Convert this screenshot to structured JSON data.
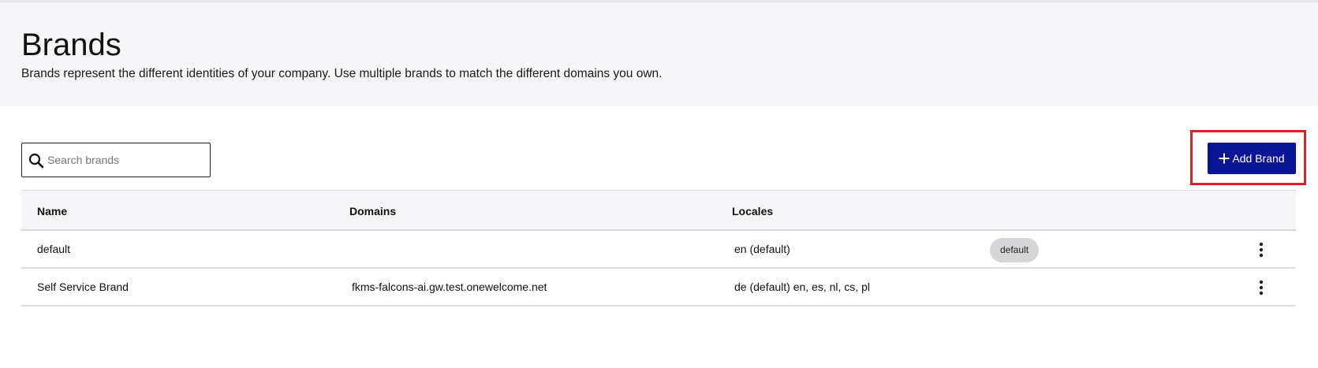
{
  "header": {
    "title": "Brands",
    "description": "Brands represent the different identities of your company. Use multiple brands to match the different domains you own."
  },
  "toolbar": {
    "search_placeholder": "Search brands",
    "search_value": "",
    "add_label": "Add Brand"
  },
  "table": {
    "columns": [
      "Name",
      "Domains",
      "Locales"
    ],
    "rows": [
      {
        "name": "default",
        "domains": "",
        "locales": "en (default)",
        "badge": "default"
      },
      {
        "name": "Self Service Brand",
        "domains": "fkms-falcons-ai.gw.test.onewelcome.net",
        "locales": "de (default) en, es, nl, cs, pl",
        "badge": ""
      }
    ]
  },
  "colors": {
    "primary": "#0a1596",
    "highlight": "#e12020",
    "header_bg": "#f6f6f8",
    "badge_bg": "#d6d6d8"
  },
  "icons": {
    "search": "search-icon",
    "add": "plus-icon",
    "row_menu": "more-vertical-icon"
  }
}
